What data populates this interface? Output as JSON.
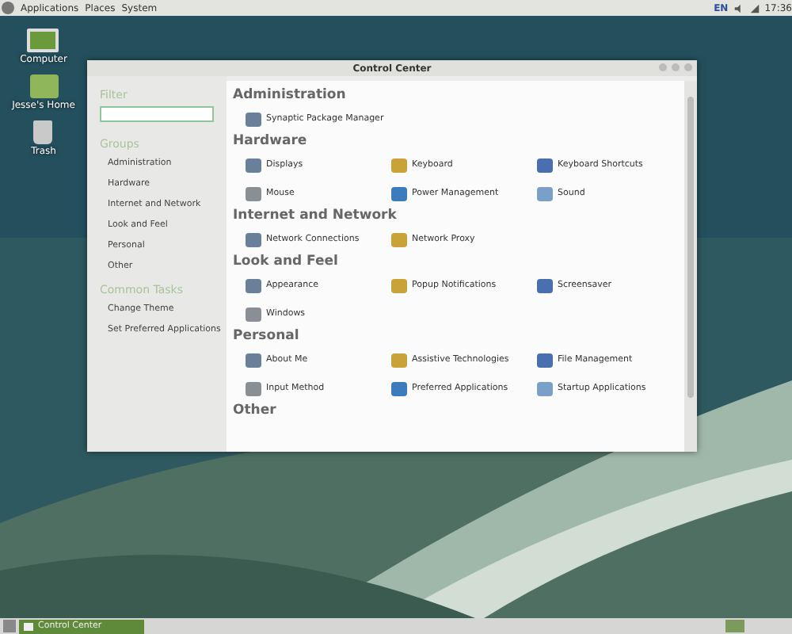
{
  "top_panel": {
    "menus": [
      "Applications",
      "Places",
      "System"
    ],
    "keyboard_layout": "EN",
    "clock": "17:36"
  },
  "desktop_icons": [
    {
      "label": "Computer"
    },
    {
      "label": "Jesse's Home"
    },
    {
      "label": "Trash"
    }
  ],
  "window": {
    "title": "Control Center"
  },
  "sidebar": {
    "filter_heading": "Filter",
    "groups_heading": "Groups",
    "groups": [
      "Administration",
      "Hardware",
      "Internet and Network",
      "Look and Feel",
      "Personal",
      "Other"
    ],
    "tasks_heading": "Common Tasks",
    "tasks": [
      "Change Theme",
      "Set Preferred Applications"
    ]
  },
  "sections": [
    {
      "title": "Administration",
      "items": [
        "Synaptic Package Manager"
      ]
    },
    {
      "title": "Hardware",
      "items": [
        "Displays",
        "Keyboard",
        "Keyboard Shortcuts",
        "Mouse",
        "Power Management",
        "Sound"
      ]
    },
    {
      "title": "Internet and Network",
      "items": [
        "Network Connections",
        "Network Proxy"
      ]
    },
    {
      "title": "Look and Feel",
      "items": [
        "Appearance",
        "Popup Notifications",
        "Screensaver",
        "Windows"
      ]
    },
    {
      "title": "Personal",
      "items": [
        "About Me",
        "Assistive Technologies",
        "File Management",
        "Input Method",
        "Preferred Applications",
        "Startup Applications"
      ]
    },
    {
      "title": "Other"
    }
  ],
  "taskbar": {
    "tasks": [
      {
        "label": "Control Center",
        "selected": true
      }
    ]
  }
}
